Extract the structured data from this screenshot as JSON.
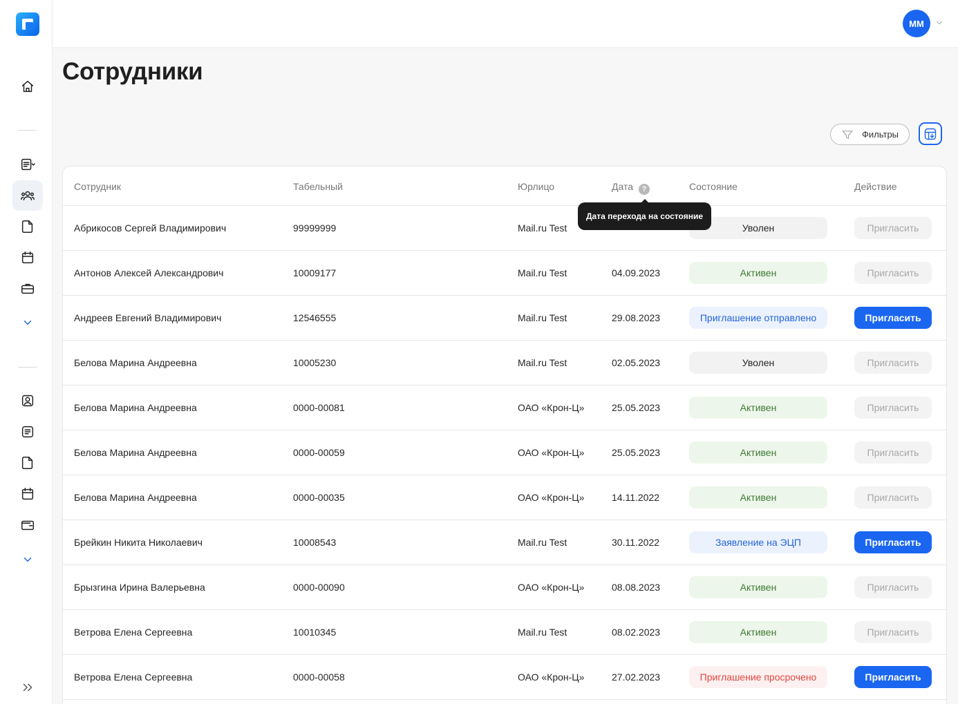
{
  "page": {
    "title": "Сотрудники"
  },
  "user": {
    "initials": "MM"
  },
  "toolbar": {
    "filters_label": "Фильтры"
  },
  "table": {
    "columns": {
      "employee": "Сотрудник",
      "tab_number": "Табельный",
      "entity": "Юрлицо",
      "date": "Дата",
      "status": "Состояние",
      "action": "Действие"
    },
    "date_tooltip": "Дата перехода на состояние",
    "rows": [
      {
        "name": "Абрикосов Сергей Владимирович",
        "tab": "99999999",
        "entity": "Mail.ru Test",
        "date": "",
        "status": "Уволен",
        "status_type": "fired",
        "action": "Пригласить",
        "action_enabled": false
      },
      {
        "name": "Антонов Алексей Александрович",
        "tab": "10009177",
        "entity": "Mail.ru Test",
        "date": "04.09.2023",
        "status": "Активен",
        "status_type": "active",
        "action": "Пригласить",
        "action_enabled": false
      },
      {
        "name": "Андреев Евгений Владимирович",
        "tab": "12546555",
        "entity": "Mail.ru Test",
        "date": "29.08.2023",
        "status": "Приглашение отправлено",
        "status_type": "sent",
        "action": "Пригласить",
        "action_enabled": true
      },
      {
        "name": "Белова Марина Андреевна",
        "tab": "10005230",
        "entity": "Mail.ru Test",
        "date": "02.05.2023",
        "status": "Уволен",
        "status_type": "fired",
        "action": "Пригласить",
        "action_enabled": false
      },
      {
        "name": "Белова Марина Андреевна",
        "tab": "0000-00081",
        "entity": "ОАО «Крон-Ц»",
        "date": "25.05.2023",
        "status": "Активен",
        "status_type": "active",
        "action": "Пригласить",
        "action_enabled": false
      },
      {
        "name": "Белова Марина Андреевна",
        "tab": "0000-00059",
        "entity": "ОАО «Крон-Ц»",
        "date": "25.05.2023",
        "status": "Активен",
        "status_type": "active",
        "action": "Пригласить",
        "action_enabled": false
      },
      {
        "name": "Белова Марина Андреевна",
        "tab": "0000-00035",
        "entity": "ОАО «Крон-Ц»",
        "date": "14.11.2022",
        "status": "Активен",
        "status_type": "active",
        "action": "Пригласить",
        "action_enabled": false
      },
      {
        "name": "Брейкин Никита Николаевич",
        "tab": "10008543",
        "entity": "Mail.ru Test",
        "date": "30.11.2022",
        "status": "Заявление на ЭЦП",
        "status_type": "ecp",
        "action": "Пригласить",
        "action_enabled": true
      },
      {
        "name": "Брызгина Ирина Валерьевна",
        "tab": "0000-00090",
        "entity": "ОАО «Крон-Ц»",
        "date": "08.08.2023",
        "status": "Активен",
        "status_type": "active",
        "action": "Пригласить",
        "action_enabled": false
      },
      {
        "name": "Ветрова Елена Сергеевна",
        "tab": "10010345",
        "entity": "Mail.ru Test",
        "date": "08.02.2023",
        "status": "Активен",
        "status_type": "active",
        "action": "Пригласить",
        "action_enabled": false
      },
      {
        "name": "Ветрова Елена Сергеевна",
        "tab": "0000-00058",
        "entity": "ОАО «Крон-Ц»",
        "date": "27.02.2023",
        "status": "Приглашение просрочено",
        "status_type": "expired",
        "action": "Пригласить",
        "action_enabled": true
      }
    ]
  },
  "sidebar": {
    "icons": [
      "home-icon",
      "documents-menu-icon",
      "employees-icon",
      "file-icon",
      "calendar-icon",
      "briefcase-icon",
      "chevron-down-icon",
      "profile-icon",
      "list-icon",
      "file-icon",
      "calendar-icon",
      "wallet-icon",
      "chevron-down-icon",
      "expand-icon"
    ]
  },
  "colors": {
    "accent": "#1a66f0",
    "active_bg": "#edf6ea",
    "active_fg": "#3f7a35",
    "expired_fg": "#e0463f"
  }
}
